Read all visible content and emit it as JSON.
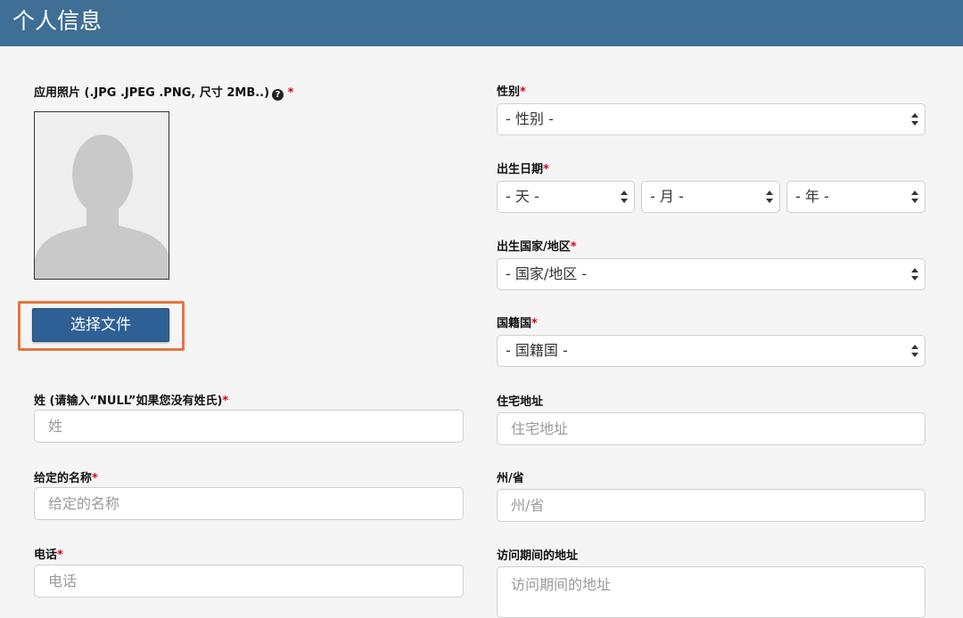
{
  "header": {
    "title": "个人信息"
  },
  "photo": {
    "label": "应用照片 (.JPG .JPEG .PNG, 尺寸 2MB..)",
    "help_icon": "?",
    "required_mark": "*",
    "upload_button": "选择文件"
  },
  "left_fields": {
    "surname": {
      "label": "姓 (请输入“NULL”如果您没有姓氏)",
      "required_mark": "*",
      "placeholder": "姓"
    },
    "given_name": {
      "label": "给定的名称",
      "required_mark": "*",
      "placeholder": "给定的名称"
    },
    "phone": {
      "label": "电话",
      "required_mark": "*",
      "placeholder": "电话"
    }
  },
  "right_fields": {
    "gender": {
      "label": "性别",
      "required_mark": "*",
      "value": "- 性别 -"
    },
    "birth_date": {
      "label": "出生日期",
      "required_mark": "*",
      "day": "- 天 -",
      "month": "- 月 -",
      "year": "- 年 -"
    },
    "birth_country": {
      "label": "出生国家/地区",
      "required_mark": "*",
      "value": "- 国家/地区 -"
    },
    "nationality": {
      "label": "国籍国",
      "required_mark": "*",
      "value": "- 国籍国 -"
    },
    "home_address": {
      "label": "住宅地址",
      "placeholder": "住宅地址"
    },
    "state": {
      "label": "州/省",
      "placeholder": "州/省"
    },
    "visit_address": {
      "label": "访问期间的地址",
      "placeholder": "访问期间的地址"
    }
  },
  "colors": {
    "header_bg": "#3f6f95",
    "button_bg": "#2f6095",
    "highlight": "#e8743b",
    "required": "#d0021b"
  }
}
